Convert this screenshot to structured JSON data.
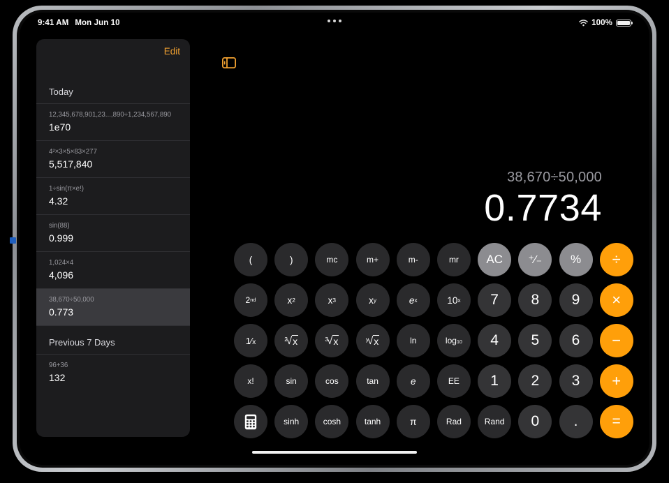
{
  "status_bar": {
    "time": "9:41 AM",
    "date": "Mon Jun 10",
    "wifi_icon": "wifi-icon",
    "battery_percent": "100%",
    "multitask_icon": "multitasking-dots-icon"
  },
  "sidebar": {
    "edit_label": "Edit",
    "toggle_icon": "sidebar-toggle-icon",
    "sections": [
      {
        "header": "Today",
        "rows": [
          {
            "expression": "12,345,678,901,23...,890÷1,234,567,890",
            "result": "1e70",
            "selected": false
          },
          {
            "expression": "4²×3×5×83×277",
            "result": "5,517,840",
            "selected": false
          },
          {
            "expression": "1÷sin(π×e!)",
            "result": "4.32",
            "selected": false
          },
          {
            "expression": "sin(88)",
            "result": "0.999",
            "selected": false
          },
          {
            "expression": "1,024×4",
            "result": "4,096",
            "selected": false
          },
          {
            "expression": "38,670÷50,000",
            "result": "0.773",
            "selected": true
          }
        ]
      },
      {
        "header": "Previous 7 Days",
        "rows": [
          {
            "expression": "96+36",
            "result": "132",
            "selected": false
          }
        ]
      }
    ]
  },
  "calculator": {
    "expression": "38,670÷50,000",
    "result": "0.7734",
    "keys": [
      {
        "label": "(",
        "type": "fn",
        "name": "open-paren"
      },
      {
        "label": ")",
        "type": "fn",
        "name": "close-paren"
      },
      {
        "label": "mc",
        "type": "fn",
        "name": "memory-clear"
      },
      {
        "label": "m+",
        "type": "fn",
        "name": "memory-add"
      },
      {
        "label": "m-",
        "type": "fn",
        "name": "memory-subtract"
      },
      {
        "label": "mr",
        "type": "fn",
        "name": "memory-recall"
      },
      {
        "label": "AC",
        "type": "util",
        "name": "all-clear"
      },
      {
        "label": "⁺⁄₋",
        "type": "util",
        "name": "plus-minus"
      },
      {
        "label": "%",
        "type": "util",
        "name": "percent"
      },
      {
        "label": "÷",
        "type": "op",
        "name": "divide"
      },
      {
        "label": "2nd",
        "type": "fn",
        "name": "second-function",
        "sup": "nd",
        "base": "2"
      },
      {
        "label": "x²",
        "type": "fn",
        "name": "x-squared"
      },
      {
        "label": "x³",
        "type": "fn",
        "name": "x-cubed"
      },
      {
        "label": "xʸ",
        "type": "fn",
        "name": "x-to-the-y"
      },
      {
        "label": "eˣ",
        "type": "fn",
        "name": "e-to-the-x"
      },
      {
        "label": "10ˣ",
        "type": "fn",
        "name": "ten-to-the-x"
      },
      {
        "label": "7",
        "type": "num",
        "name": "digit-7"
      },
      {
        "label": "8",
        "type": "num",
        "name": "digit-8"
      },
      {
        "label": "9",
        "type": "num",
        "name": "digit-9"
      },
      {
        "label": "×",
        "type": "op",
        "name": "multiply"
      },
      {
        "label": "1/x",
        "type": "fn",
        "name": "reciprocal"
      },
      {
        "label": "²√x",
        "type": "fn",
        "name": "square-root"
      },
      {
        "label": "³√x",
        "type": "fn",
        "name": "cube-root"
      },
      {
        "label": "ʸ√x",
        "type": "fn",
        "name": "yth-root"
      },
      {
        "label": "ln",
        "type": "fn",
        "name": "natural-log"
      },
      {
        "label": "log10",
        "type": "fn",
        "name": "log-base-10"
      },
      {
        "label": "4",
        "type": "num",
        "name": "digit-4"
      },
      {
        "label": "5",
        "type": "num",
        "name": "digit-5"
      },
      {
        "label": "6",
        "type": "num",
        "name": "digit-6"
      },
      {
        "label": "−",
        "type": "op",
        "name": "subtract"
      },
      {
        "label": "x!",
        "type": "fn",
        "name": "factorial"
      },
      {
        "label": "sin",
        "type": "fn",
        "name": "sine"
      },
      {
        "label": "cos",
        "type": "fn",
        "name": "cosine"
      },
      {
        "label": "tan",
        "type": "fn",
        "name": "tangent"
      },
      {
        "label": "e",
        "type": "fn",
        "name": "euler-constant"
      },
      {
        "label": "EE",
        "type": "fn",
        "name": "exponent-entry"
      },
      {
        "label": "1",
        "type": "num",
        "name": "digit-1"
      },
      {
        "label": "2",
        "type": "num",
        "name": "digit-2"
      },
      {
        "label": "3",
        "type": "num",
        "name": "digit-3"
      },
      {
        "label": "+",
        "type": "op",
        "name": "add"
      },
      {
        "label": "calculator-icon",
        "type": "fn",
        "name": "calculator-mode-icon"
      },
      {
        "label": "sinh",
        "type": "fn",
        "name": "hyperbolic-sine"
      },
      {
        "label": "cosh",
        "type": "fn",
        "name": "hyperbolic-cosine"
      },
      {
        "label": "tanh",
        "type": "fn",
        "name": "hyperbolic-tangent"
      },
      {
        "label": "π",
        "type": "fn",
        "name": "pi"
      },
      {
        "label": "Rad",
        "type": "fn",
        "name": "radians-toggle"
      },
      {
        "label": "Rand",
        "type": "fn",
        "name": "random"
      },
      {
        "label": "0",
        "type": "num",
        "name": "digit-0"
      },
      {
        "label": ".",
        "type": "num",
        "name": "decimal-point"
      },
      {
        "label": "=",
        "type": "op",
        "name": "equals"
      }
    ]
  },
  "colors": {
    "accent_orange": "#ff9f0a",
    "edit_orange": "#f0a030",
    "sidebar_bg": "#1c1c1e",
    "selected_row": "#3a3a3e",
    "key_fn": "#2a2a2c",
    "key_num": "#343436",
    "key_util": "#8c8c90"
  }
}
